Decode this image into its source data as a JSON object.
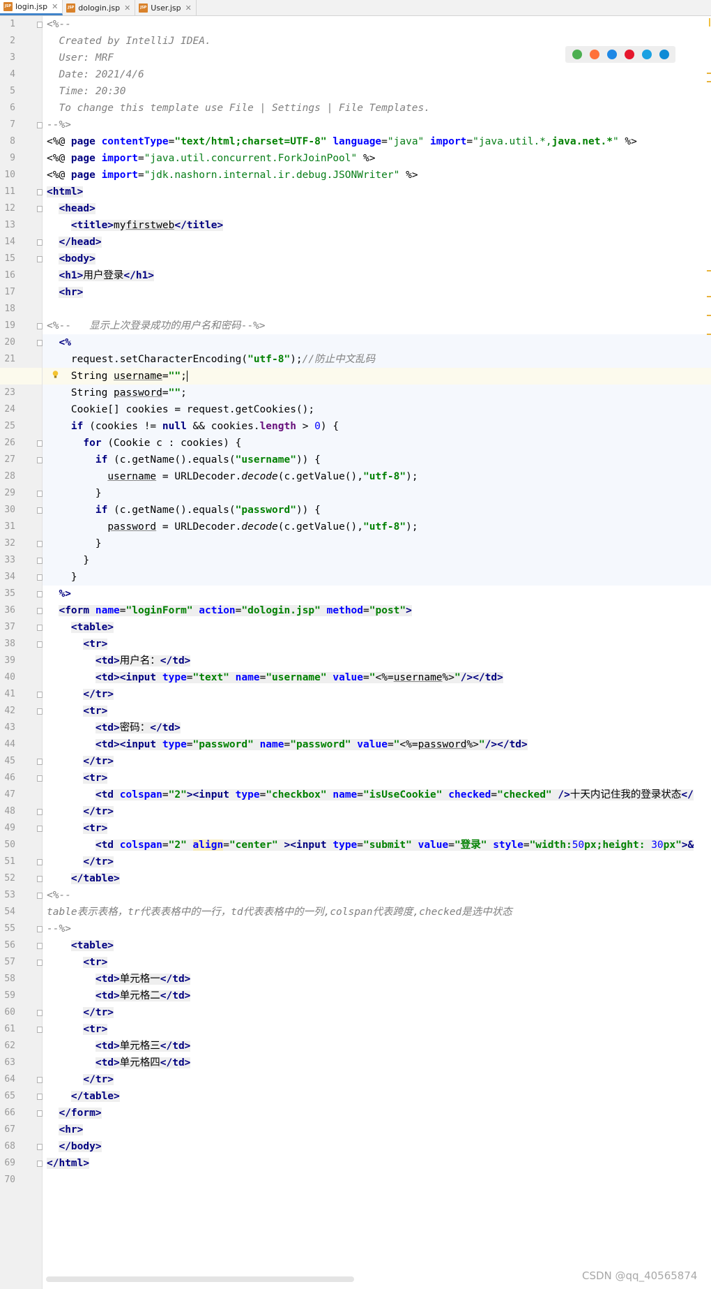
{
  "tabs": [
    {
      "name": "login.jsp",
      "icon": "JSP",
      "active": true
    },
    {
      "name": "dologin.jsp",
      "icon": "JSP",
      "active": false
    },
    {
      "name": "User.jsp",
      "icon": "JSP",
      "active": false
    }
  ],
  "browser_icons": [
    "chrome-icon",
    "firefox-icon",
    "safari-icon",
    "opera-icon",
    "ie-icon",
    "edge-icon"
  ],
  "watermark": "CSDN @qq_40565874",
  "lines": [
    [
      [
        "cm",
        "<%--"
      ]
    ],
    [
      [
        "cm",
        "  Created by IntelliJ IDEA."
      ]
    ],
    [
      [
        "cm",
        "  User: MRF"
      ]
    ],
    [
      [
        "cm",
        "  Date: 2021/4/6"
      ]
    ],
    [
      [
        "cm",
        "  Time: 20:30"
      ]
    ],
    [
      [
        "cm",
        "  To change this template use File | Settings | File Templates."
      ]
    ],
    [
      [
        "cm",
        "--%>"
      ]
    ],
    [
      [
        "t",
        "<%@ "
      ],
      [
        "kw",
        "page "
      ],
      [
        "attr",
        "contentType"
      ],
      [
        "t",
        "="
      ],
      [
        "str",
        "\"text/html;charset=UTF-8\""
      ],
      [
        "t",
        " "
      ],
      [
        "attr",
        "language"
      ],
      [
        "t",
        "="
      ],
      [
        "sstr",
        "\"java\""
      ],
      [
        "t",
        " "
      ],
      [
        "attr",
        "import"
      ],
      [
        "t",
        "="
      ],
      [
        "sstr",
        "\"java.util.*,"
      ],
      [
        "str",
        "java.net.*"
      ],
      [
        "sstr",
        "\""
      ],
      [
        "t",
        " %>"
      ]
    ],
    [
      [
        "t",
        "<%@ "
      ],
      [
        "kw",
        "page "
      ],
      [
        "attr",
        "import"
      ],
      [
        "t",
        "="
      ],
      [
        "sstr",
        "\"java.util.concurrent.ForkJoinPool\""
      ],
      [
        "t",
        " %>"
      ]
    ],
    [
      [
        "t",
        "<%@ "
      ],
      [
        "kw",
        "page "
      ],
      [
        "attr",
        "import"
      ],
      [
        "t",
        "="
      ],
      [
        "sstr",
        "\"jdk.nashorn.internal.ir.debug.JSONWriter\""
      ],
      [
        "t",
        " %>"
      ]
    ],
    [
      [
        "tag",
        "<html>"
      ]
    ],
    [
      [
        "t",
        "  "
      ],
      [
        "tag",
        "<head>"
      ]
    ],
    [
      [
        "t",
        "    "
      ],
      [
        "tag",
        "<title>"
      ],
      [
        "tb",
        "my"
      ],
      [
        "tbu",
        "firstweb"
      ],
      [
        "tag",
        "</title>"
      ]
    ],
    [
      [
        "t",
        "  "
      ],
      [
        "tag",
        "</head>"
      ]
    ],
    [
      [
        "t",
        "  "
      ],
      [
        "tag",
        "<body>"
      ]
    ],
    [
      [
        "t",
        "  "
      ],
      [
        "tag",
        "<h1>"
      ],
      [
        "tb",
        "用户登录"
      ],
      [
        "tag",
        "</h1>"
      ]
    ],
    [
      [
        "t",
        "  "
      ],
      [
        "tag",
        "<hr>"
      ]
    ],
    [],
    [
      [
        "cmd",
        "<%--   "
      ],
      [
        "cm",
        "显示上次登录成功的用户名和密码"
      ],
      [
        "cmd",
        "--%>"
      ]
    ],
    [
      [
        "t",
        "  "
      ],
      [
        "kw",
        "<%"
      ]
    ],
    [
      [
        "t",
        "    request.setCharacterEncoding("
      ],
      [
        "str",
        "\"utf-8\""
      ],
      [
        "t",
        ");"
      ],
      [
        "cm",
        "//防止中文乱码"
      ]
    ],
    [
      [
        "t",
        "    String "
      ],
      [
        "u",
        "username"
      ],
      [
        "t",
        "="
      ],
      [
        "str",
        "\"\""
      ],
      [
        "t",
        ";"
      ],
      [
        "caret",
        ""
      ]
    ],
    [
      [
        "t",
        "    String "
      ],
      [
        "u",
        "password"
      ],
      [
        "t",
        "="
      ],
      [
        "str",
        "\"\""
      ],
      [
        "t",
        ";"
      ]
    ],
    [
      [
        "t",
        "    Cookie[] cookies = request.getCookies();"
      ]
    ],
    [
      [
        "t",
        "    "
      ],
      [
        "kw",
        "if"
      ],
      [
        "t",
        " (cookies != "
      ],
      [
        "kw",
        "null"
      ],
      [
        "t",
        " && cookies."
      ],
      [
        "fld",
        "length"
      ],
      [
        "t",
        " > "
      ],
      [
        "num",
        "0"
      ],
      [
        "t",
        ") {"
      ]
    ],
    [
      [
        "t",
        "      "
      ],
      [
        "kw",
        "for"
      ],
      [
        "t",
        " (Cookie c : cookies) {"
      ]
    ],
    [
      [
        "t",
        "        "
      ],
      [
        "kw",
        "if"
      ],
      [
        "t",
        " (c.getName().equals("
      ],
      [
        "str",
        "\"username\""
      ],
      [
        "t",
        ")) {"
      ]
    ],
    [
      [
        "t",
        "          "
      ],
      [
        "u",
        "username"
      ],
      [
        "t",
        " = URLDecoder."
      ],
      [
        "it",
        "decode"
      ],
      [
        "t",
        "(c.getValue(),"
      ],
      [
        "str",
        "\"utf-8\""
      ],
      [
        "t",
        ");"
      ]
    ],
    [
      [
        "t",
        "        }"
      ]
    ],
    [
      [
        "t",
        "        "
      ],
      [
        "kw",
        "if"
      ],
      [
        "t",
        " (c.getName().equals("
      ],
      [
        "str",
        "\"password\""
      ],
      [
        "t",
        ")) {"
      ]
    ],
    [
      [
        "t",
        "          "
      ],
      [
        "u",
        "password"
      ],
      [
        "t",
        " = URLDecoder."
      ],
      [
        "it",
        "decode"
      ],
      [
        "t",
        "(c.getValue(),"
      ],
      [
        "str",
        "\"utf-8\""
      ],
      [
        "t",
        ");"
      ]
    ],
    [
      [
        "t",
        "        }"
      ]
    ],
    [
      [
        "t",
        "      }"
      ]
    ],
    [
      [
        "t",
        "    }"
      ]
    ],
    [
      [
        "t",
        "  "
      ],
      [
        "kw",
        "%>"
      ]
    ],
    [
      [
        "t",
        "  "
      ],
      [
        "tag",
        "<form "
      ],
      [
        "attrb",
        "name"
      ],
      [
        "tb",
        "="
      ],
      [
        "strb",
        "\"loginForm\""
      ],
      [
        "tb",
        " "
      ],
      [
        "attrb",
        "action"
      ],
      [
        "tb",
        "="
      ],
      [
        "strb",
        "\"dologin.jsp\""
      ],
      [
        "tb",
        " "
      ],
      [
        "attrb",
        "method"
      ],
      [
        "tb",
        "="
      ],
      [
        "strb",
        "\"post\""
      ],
      [
        "tag",
        ">"
      ]
    ],
    [
      [
        "t",
        "    "
      ],
      [
        "tag",
        "<table>"
      ]
    ],
    [
      [
        "t",
        "      "
      ],
      [
        "tag",
        "<tr>"
      ]
    ],
    [
      [
        "t",
        "        "
      ],
      [
        "tag",
        "<td>"
      ],
      [
        "tb",
        "用户名："
      ],
      [
        "tag",
        "</td>"
      ]
    ],
    [
      [
        "t",
        "        "
      ],
      [
        "tag",
        "<td><input "
      ],
      [
        "attrb",
        "type"
      ],
      [
        "tb",
        "="
      ],
      [
        "strb",
        "\"text\""
      ],
      [
        "tb",
        " "
      ],
      [
        "attrb",
        "name"
      ],
      [
        "tb",
        "="
      ],
      [
        "strb",
        "\"username\""
      ],
      [
        "tb",
        " "
      ],
      [
        "attrb",
        "value"
      ],
      [
        "tb",
        "="
      ],
      [
        "strb",
        "\""
      ],
      [
        "tb",
        "<%="
      ],
      [
        "tbu",
        "username"
      ],
      [
        "tb",
        "%>"
      ],
      [
        "strb",
        "\""
      ],
      [
        "tag",
        "/></td>"
      ]
    ],
    [
      [
        "t",
        "      "
      ],
      [
        "tag",
        "</tr>"
      ]
    ],
    [
      [
        "t",
        "      "
      ],
      [
        "tag",
        "<tr>"
      ]
    ],
    [
      [
        "t",
        "        "
      ],
      [
        "tag",
        "<td>"
      ],
      [
        "tb",
        "密码："
      ],
      [
        "tag",
        "</td>"
      ]
    ],
    [
      [
        "t",
        "        "
      ],
      [
        "tag",
        "<td><input "
      ],
      [
        "attrb",
        "type"
      ],
      [
        "tb",
        "="
      ],
      [
        "strb",
        "\"password\""
      ],
      [
        "tb",
        " "
      ],
      [
        "attrb",
        "name"
      ],
      [
        "tb",
        "="
      ],
      [
        "strb",
        "\"password\""
      ],
      [
        "tb",
        " "
      ],
      [
        "attrb",
        "value"
      ],
      [
        "tb",
        "="
      ],
      [
        "strb",
        "\""
      ],
      [
        "tb",
        "<%="
      ],
      [
        "tbu",
        "password"
      ],
      [
        "tb",
        "%>"
      ],
      [
        "strb",
        "\""
      ],
      [
        "tag",
        "/></td>"
      ]
    ],
    [
      [
        "t",
        "      "
      ],
      [
        "tag",
        "</tr>"
      ]
    ],
    [
      [
        "t",
        "      "
      ],
      [
        "tag",
        "<tr>"
      ]
    ],
    [
      [
        "t",
        "        "
      ],
      [
        "tag",
        "<td "
      ],
      [
        "attrb",
        "colspan"
      ],
      [
        "tb",
        "="
      ],
      [
        "strb",
        "\"2\""
      ],
      [
        "tag",
        "><input "
      ],
      [
        "attrb",
        "type"
      ],
      [
        "tb",
        "="
      ],
      [
        "strb",
        "\"checkbox\""
      ],
      [
        "tb",
        " "
      ],
      [
        "attrb",
        "name"
      ],
      [
        "tb",
        "="
      ],
      [
        "strb",
        "\"isUseCookie\""
      ],
      [
        "tb",
        " "
      ],
      [
        "attrb",
        "checked"
      ],
      [
        "tb",
        "="
      ],
      [
        "strb",
        "\"checked\""
      ],
      [
        "tb",
        " "
      ],
      [
        "tag",
        "/>"
      ],
      [
        "tb",
        "十天内记住我的登录状态"
      ],
      [
        "tag",
        "</"
      ]
    ],
    [
      [
        "t",
        "      "
      ],
      [
        "tag",
        "</tr>"
      ]
    ],
    [
      [
        "t",
        "      "
      ],
      [
        "tag",
        "<tr>"
      ]
    ],
    [
      [
        "t",
        "        "
      ],
      [
        "tag",
        "<td "
      ],
      [
        "attrb",
        "colspan"
      ],
      [
        "tb",
        "="
      ],
      [
        "strb",
        "\"2\""
      ],
      [
        "tb",
        " "
      ],
      [
        "attrs",
        "align"
      ],
      [
        "tb",
        "="
      ],
      [
        "strb",
        "\"center\""
      ],
      [
        "tb",
        " "
      ],
      [
        "tag",
        "><input "
      ],
      [
        "attrb",
        "type"
      ],
      [
        "tb",
        "="
      ],
      [
        "strb",
        "\"submit\""
      ],
      [
        "tb",
        " "
      ],
      [
        "attrb",
        "value"
      ],
      [
        "tb",
        "="
      ],
      [
        "strb",
        "\"登录\""
      ],
      [
        "tb",
        " "
      ],
      [
        "attrb",
        "style"
      ],
      [
        "tb",
        "="
      ],
      [
        "strb",
        "\"width:"
      ],
      [
        "numb",
        "50"
      ],
      [
        "strb",
        "px;height: "
      ],
      [
        "numb",
        "30"
      ],
      [
        "strb",
        "px\""
      ],
      [
        "tag",
        ">&"
      ]
    ],
    [
      [
        "t",
        "      "
      ],
      [
        "tag",
        "</tr>"
      ]
    ],
    [
      [
        "t",
        "    "
      ],
      [
        "tag",
        "</table>"
      ]
    ],
    [
      [
        "cm",
        "<%--"
      ]
    ],
    [
      [
        "cm",
        "table"
      ],
      [
        "cm",
        "表示表格，"
      ],
      [
        "cm",
        "tr"
      ],
      [
        "cm",
        "代表表格中的一行，"
      ],
      [
        "cm",
        "td"
      ],
      [
        "cm",
        "代表表格中的一列,"
      ],
      [
        "cm",
        "colspan"
      ],
      [
        "cm",
        "代表跨度,"
      ],
      [
        "cm",
        "checked"
      ],
      [
        "cm",
        "是选中状态"
      ]
    ],
    [
      [
        "cm",
        "--%>"
      ]
    ],
    [
      [
        "t",
        "    "
      ],
      [
        "tag",
        "<table>"
      ]
    ],
    [
      [
        "t",
        "      "
      ],
      [
        "tag",
        "<tr>"
      ]
    ],
    [
      [
        "t",
        "        "
      ],
      [
        "tag",
        "<td>"
      ],
      [
        "tb",
        "单元格一"
      ],
      [
        "tag",
        "</td>"
      ]
    ],
    [
      [
        "t",
        "        "
      ],
      [
        "tag",
        "<td>"
      ],
      [
        "tb",
        "单元格二"
      ],
      [
        "tag",
        "</td>"
      ]
    ],
    [
      [
        "t",
        "      "
      ],
      [
        "tag",
        "</tr>"
      ]
    ],
    [
      [
        "t",
        "      "
      ],
      [
        "tag",
        "<tr>"
      ]
    ],
    [
      [
        "t",
        "        "
      ],
      [
        "tag",
        "<td>"
      ],
      [
        "tb",
        "单元格三"
      ],
      [
        "tag",
        "</td>"
      ]
    ],
    [
      [
        "t",
        "        "
      ],
      [
        "tag",
        "<td>"
      ],
      [
        "tb",
        "单元格四"
      ],
      [
        "tag",
        "</td>"
      ]
    ],
    [
      [
        "t",
        "      "
      ],
      [
        "tag",
        "</tr>"
      ]
    ],
    [
      [
        "t",
        "    "
      ],
      [
        "tag",
        "</table>"
      ]
    ],
    [
      [
        "t",
        "  "
      ],
      [
        "tag",
        "</form>"
      ]
    ],
    [
      [
        "t",
        "  "
      ],
      [
        "tag",
        "<hr>"
      ]
    ],
    [
      [
        "t",
        "  "
      ],
      [
        "tag",
        "</body>"
      ]
    ],
    [
      [
        "tag",
        "</html>"
      ]
    ],
    []
  ]
}
